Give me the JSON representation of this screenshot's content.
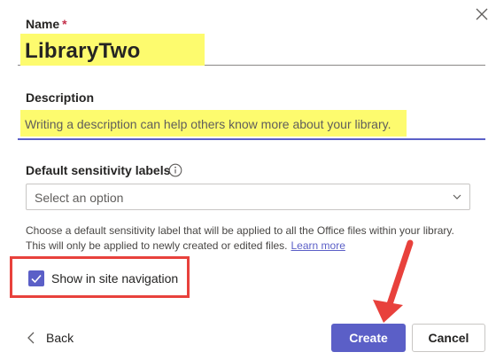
{
  "name_field": {
    "label": "Name",
    "required_marker": "*",
    "value": "LibraryTwo"
  },
  "description_field": {
    "label": "Description",
    "placeholder": "Writing a description can help others know more about your library."
  },
  "sensitivity": {
    "label": "Default sensitivity labels",
    "info_icon": "info-icon",
    "select_placeholder": "Select an option",
    "helper_text": "Choose a default sensitivity label that will be applied to all the Office files within your library. This will only be applied to newly created or edited files.",
    "learn_more": "Learn more"
  },
  "site_navigation": {
    "label": "Show in site navigation",
    "checked": true
  },
  "footer": {
    "back_label": "Back",
    "create_label": "Create",
    "cancel_label": "Cancel"
  },
  "colors": {
    "accent": "#5b5fc7",
    "highlight": "#fdfb6e",
    "annotation_red": "#e8413c",
    "required": "#c4314b"
  }
}
